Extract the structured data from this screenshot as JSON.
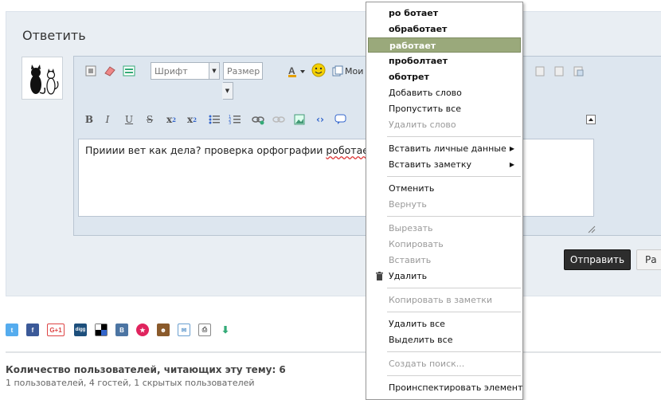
{
  "reply": {
    "title": "Ответить",
    "font_placeholder": "Шрифт",
    "size_placeholder": "Размер",
    "my_label": "Мои",
    "text_before": "Прииии вет как дела? проверка орфографии ",
    "text_misspelled": "роботает"
  },
  "buttons": {
    "send": "Отправить",
    "extra": "Ра"
  },
  "users": {
    "heading": "Количество пользователей, читающих эту тему: 6",
    "sub": "1 пользователей, 4 гостей, 1 скрытых пользователей"
  },
  "social_icons": [
    "twitter-icon",
    "facebook-icon",
    "gplus-icon",
    "digg-icon",
    "delicious-icon",
    "vkontakte-icon",
    "myworld-icon",
    "odnoklassniki-icon",
    "email-icon",
    "print-icon",
    "download-icon"
  ],
  "context_menu": {
    "suggestions": [
      "ро ботает",
      "обработает",
      "работает",
      "проболтает",
      "оботрет"
    ],
    "add_word": "Добавить слово",
    "skip_all": "Пропустить все",
    "delete_word": "Удалить слово",
    "insert_personal": "Вставить личные данные",
    "insert_note": "Вставить заметку",
    "undo": "Отменить",
    "redo": "Вернуть",
    "cut": "Вырезать",
    "copy": "Копировать",
    "paste": "Вставить",
    "delete": "Удалить",
    "copy_to_notes": "Копировать в заметки",
    "delete_all": "Удалить все",
    "select_all": "Выделить все",
    "create_search": "Создать поиск...",
    "inspect": "Проинспектировать элемент"
  },
  "colors": {
    "highlight": "#9aa97b",
    "send_button": "#2d2d2d",
    "panel_bg": "#e9eef3"
  }
}
